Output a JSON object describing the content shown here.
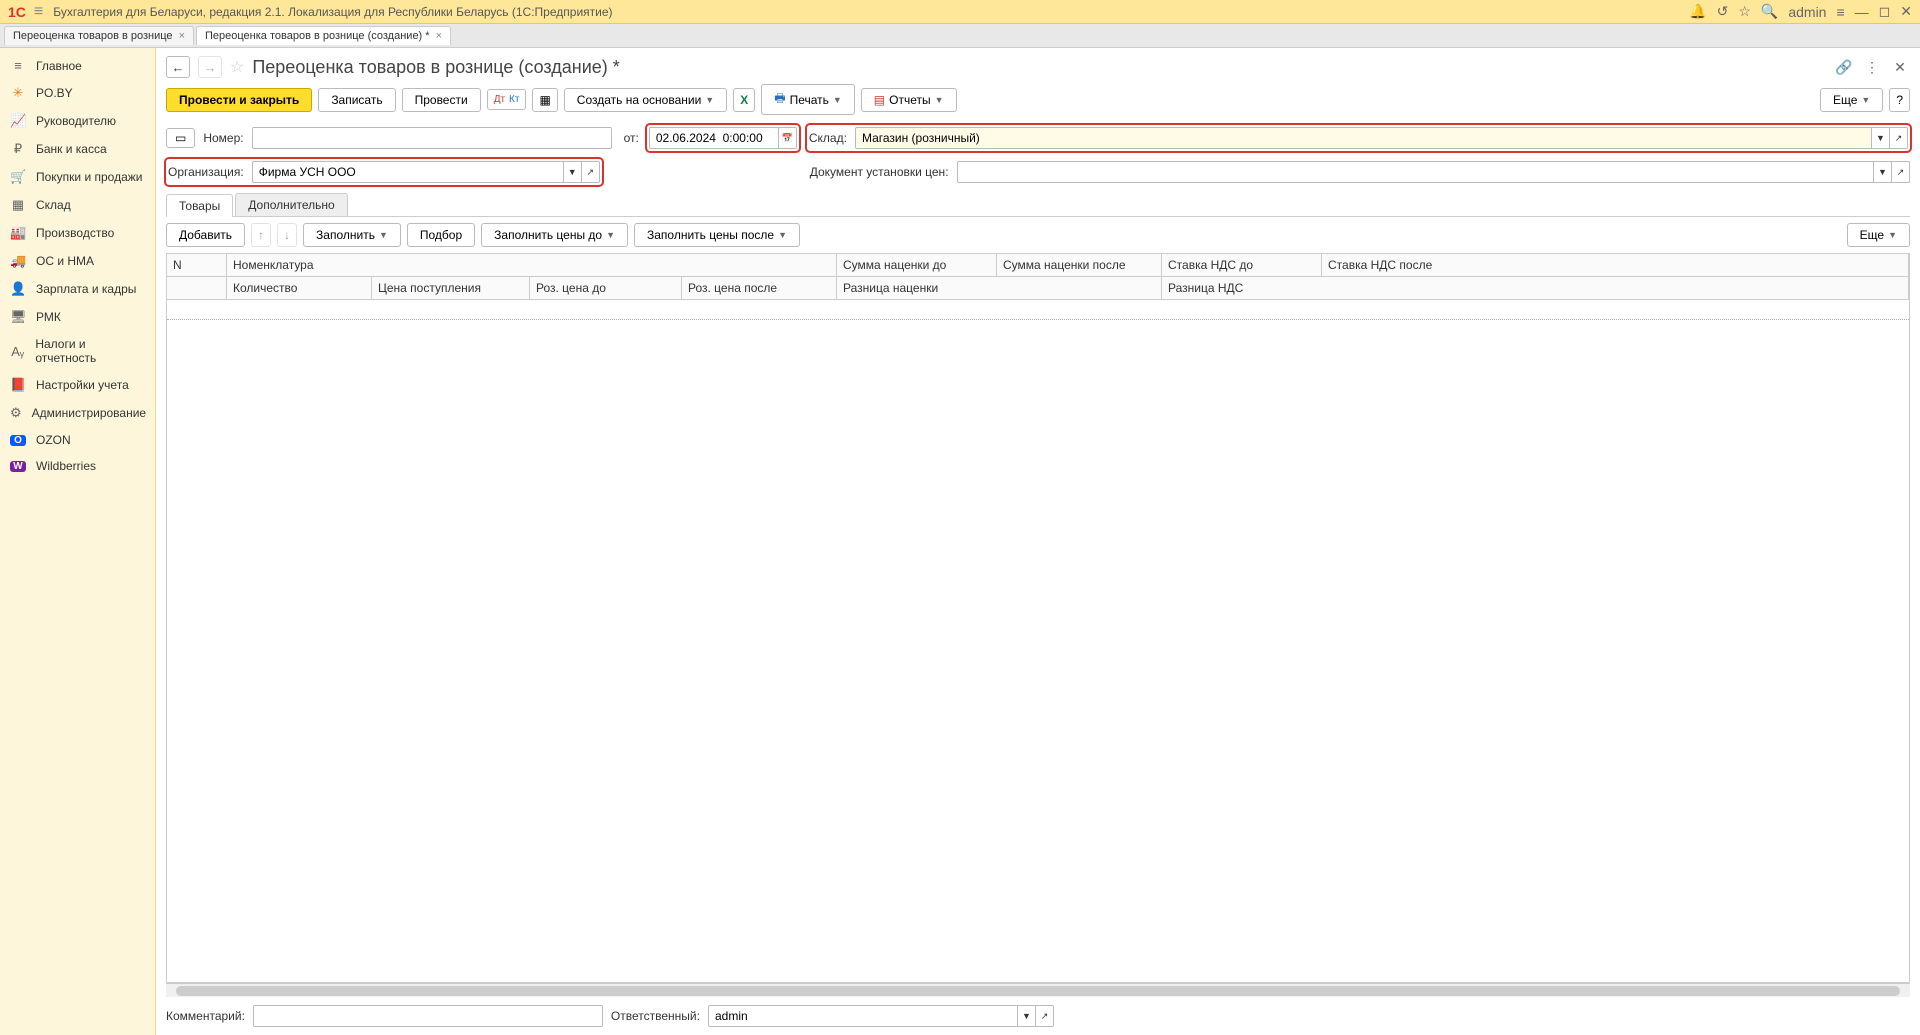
{
  "titlebar": {
    "logo": "1C",
    "title": "Бухгалтерия для Беларуси, редакция 2.1. Локализация для Республики Беларусь  (1С:Предприятие)",
    "user": "admin"
  },
  "tabs": [
    {
      "label": "Переоценка товаров в рознице",
      "active": false
    },
    {
      "label": "Переоценка товаров в рознице (создание) *",
      "active": true
    }
  ],
  "sidebar": [
    {
      "icon": "≡",
      "label": "Главное"
    },
    {
      "icon": "✳",
      "label": "PO.BY"
    },
    {
      "icon": "📈",
      "label": "Руководителю"
    },
    {
      "icon": "₽",
      "label": "Банк и касса"
    },
    {
      "icon": "🛒",
      "label": "Покупки и продажи"
    },
    {
      "icon": "▦",
      "label": "Склад"
    },
    {
      "icon": "🏭",
      "label": "Производство"
    },
    {
      "icon": "🚚",
      "label": "ОС и НМА"
    },
    {
      "icon": "👤",
      "label": "Зарплата и кадры"
    },
    {
      "icon": "🖥",
      "label": "РМК"
    },
    {
      "icon": "Aᵧ",
      "label": "Налоги и отчетность"
    },
    {
      "icon": "📕",
      "label": "Настройки учета"
    },
    {
      "icon": "⚙",
      "label": "Администрирование"
    },
    {
      "icon": "O",
      "label": "OZON"
    },
    {
      "icon": "W",
      "label": "Wildberries"
    }
  ],
  "page": {
    "title": "Переоценка товаров в рознице (создание) *"
  },
  "toolbar": {
    "post_close": "Провести и закрыть",
    "write": "Записать",
    "post": "Провести",
    "create_based": "Создать на основании",
    "print": "Печать",
    "reports": "Отчеты",
    "more": "Еще"
  },
  "form": {
    "number_label": "Номер:",
    "number_value": "",
    "date_label": "от:",
    "date_value": "02.06.2024  0:00:00",
    "warehouse_label": "Склад:",
    "warehouse_value": "Магазин (розничный)",
    "org_label": "Организация:",
    "org_value": "Фирма УСН ООО",
    "pricedoc_label": "Документ установки цен:",
    "pricedoc_value": ""
  },
  "inner_tabs": {
    "goods": "Товары",
    "additional": "Дополнительно"
  },
  "table_toolbar": {
    "add": "Добавить",
    "fill": "Заполнить",
    "pickup": "Подбор",
    "fill_before": "Заполнить цены до",
    "fill_after": "Заполнить цены после",
    "more": "Еще"
  },
  "table": {
    "headers_row1": {
      "n": "N",
      "nomenclature": "Номенклатура",
      "markup_before": "Сумма наценки до",
      "markup_after": "Сумма наценки после",
      "vat_rate_before": "Ставка НДС до",
      "vat_rate_after": "Ставка НДС после"
    },
    "headers_row2": {
      "qty": "Количество",
      "price_in": "Цена поступления",
      "retail_before": "Роз. цена до",
      "retail_after": "Роз. цена после",
      "markup_diff": "Разница наценки",
      "vat_diff": "Разница НДС"
    }
  },
  "bottom": {
    "comment_label": "Комментарий:",
    "comment_value": "",
    "responsible_label": "Ответственный:",
    "responsible_value": "admin"
  }
}
